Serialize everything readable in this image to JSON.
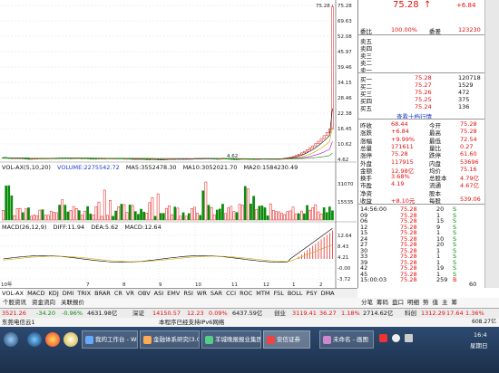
{
  "chart_data": [
    {
      "type": "candlestick",
      "name": "kline",
      "y_ticks": [
        "75.28",
        "69.63",
        "52.08",
        "45.97",
        "39.46",
        "34.15",
        "28.46",
        "22.38",
        "16.45",
        "10.62",
        "4.62"
      ],
      "max_label": "75.28",
      "min_label": "4.62"
    },
    {
      "type": "bar",
      "name": "volume",
      "y_ticks": [
        "31070",
        "15535"
      ]
    },
    {
      "type": "line",
      "name": "macd",
      "y_ticks": [
        "12.64",
        "8.43",
        "4.21",
        "-0.00",
        "-3.72"
      ]
    }
  ],
  "vol": {
    "title": "VOL-AX(5,10,20)",
    "volume": "VOLUME:2275542.72",
    "ma5": "MA5:3552478.30",
    "ma10": "MA10:3052021.70",
    "ma20": "MA20:1584230.49"
  },
  "macd": {
    "title": "MACD(26,12,9)",
    "diff": "DIFF:11.94",
    "dea": "DEA:5.62",
    "macd": "MACD:12.64"
  },
  "x_label": "10年",
  "x_ticks": [
    "7",
    "8",
    "9",
    "10",
    "11",
    "12",
    "1",
    "2"
  ],
  "panel": {
    "price": "75.28",
    "arrow": "↑",
    "change": "+6.84",
    "weibi": {
      "label": "委比",
      "val": "100.00%",
      "label2": "委差",
      "val2": "123230"
    },
    "sell": [
      {
        "l": "卖五",
        "p": "",
        "v": ""
      },
      {
        "l": "卖四",
        "p": "",
        "v": ""
      },
      {
        "l": "卖三",
        "p": "",
        "v": ""
      },
      {
        "l": "卖二",
        "p": "",
        "v": ""
      },
      {
        "l": "卖一",
        "p": "",
        "v": ""
      }
    ],
    "buy": [
      {
        "l": "买一",
        "p": "75.28",
        "v": "120718"
      },
      {
        "l": "买二",
        "p": "75.27",
        "v": "1529"
      },
      {
        "l": "买三",
        "p": "75.26",
        "v": "472"
      },
      {
        "l": "买四",
        "p": "75.25",
        "v": "375"
      },
      {
        "l": "买五",
        "p": "75.24",
        "v": "136"
      }
    ],
    "more": "查看十档行情",
    "stats": [
      {
        "l1": "昨收",
        "v1": "68.44",
        "l2": "今开",
        "v2": "75.28"
      },
      {
        "l1": "涨跌",
        "v1": "+6.84",
        "l2": "最高",
        "v2": "75.28"
      },
      {
        "l1": "涨幅",
        "v1": "+9.99%",
        "l2": "最低",
        "v2": "72.54"
      },
      {
        "l1": "总量",
        "v1": "171611",
        "l2": "量比",
        "v2": "0.27"
      },
      {
        "l1": "涨停",
        "v1": "75.28",
        "l2": "跌停",
        "v2": "61.60"
      },
      {
        "l1": "外盘",
        "v1": "117915",
        "l2": "内盘",
        "v2": "53696"
      },
      {
        "l1": "金额",
        "v1": "12.98亿",
        "l2": "均价",
        "v2": "75.16"
      },
      {
        "l1": "换手",
        "v1": "3.68%",
        "l2": "总股本",
        "v2": "4.79亿"
      },
      {
        "l1": "市盈",
        "v1": "4.19",
        "l2": "流通",
        "v2": "4.67亿"
      },
      {
        "l1": "净资",
        "v1": "",
        "l2": "股本",
        "v2": ""
      },
      {
        "l1": "收益",
        "v1": "+8.10元",
        "l2": "每股",
        "v2": "539.06"
      }
    ],
    "ticks": [
      {
        "t": "14:56:00",
        "p": "75.28",
        "v": "20",
        "d": "S"
      },
      {
        "t": "09",
        "p": "75.28",
        "v": "1",
        "d": "S"
      },
      {
        "t": "06",
        "p": "75.28",
        "v": "15",
        "d": "S"
      },
      {
        "t": "12",
        "p": "75.28",
        "v": "9",
        "d": "S"
      },
      {
        "t": "15",
        "p": "75.28",
        "v": "1",
        "d": "S"
      },
      {
        "t": "24",
        "p": "75.28",
        "v": "10",
        "d": "S"
      },
      {
        "t": "27",
        "p": "75.28",
        "v": "20",
        "d": "S"
      },
      {
        "t": "30",
        "p": "75.28",
        "v": "1",
        "d": "S"
      },
      {
        "t": "33",
        "p": "75.28",
        "v": "1",
        "d": "S"
      },
      {
        "t": "39",
        "p": "75.28",
        "v": "1",
        "d": "S"
      },
      {
        "t": "42",
        "p": "75.28",
        "v": "19",
        "d": "S"
      },
      {
        "t": "45",
        "p": "75.28",
        "v": "1",
        "d": "S"
      },
      {
        "t": "15:00:03",
        "p": "75.28",
        "v": "259",
        "d": "B"
      }
    ],
    "tick_extra": "60"
  },
  "tabs": [
    "VOL-AX",
    "MACD",
    "KDJ",
    "DMI",
    "TRIX",
    "BRAR",
    "CR",
    "VR",
    "OBV",
    "ASI",
    "EMV",
    "RSI",
    "WR",
    "SAR",
    "CCI",
    "ROC",
    "MTM",
    "FSL",
    "BOLL",
    "PSY",
    "DMA"
  ],
  "tabs2": [
    "个股资讯",
    "资金流向",
    "关联报价"
  ],
  "rtabs": [
    "分笔",
    "筹码",
    "盘口",
    "明细",
    "势",
    "值",
    "主",
    "筹"
  ],
  "status": {
    "s1": "3521.26",
    "s2": "-34.20",
    "s3": "-0.96%",
    "s4": "4631.98亿",
    "s5": "深证",
    "s6": "14150.57",
    "s7": "12.23",
    "s8": "0.09%",
    "s9": "6437.59亿",
    "s10": "创业",
    "s11": "3119.41",
    "s12": "36.27",
    "s13": "1.18%",
    "s14": "2714.62亿",
    "s15": "科创",
    "s16": "1312.29",
    "s17": "17.64",
    "s18": "1.36%",
    "s19": "608.27亿"
  },
  "ticker": {
    "left": "东莞电信云1",
    "msg": "本程序已经支持IPv6网络"
  },
  "taskbar": {
    "apps": [
      "我的工作台 - Win...",
      "金融体系研究(3.0-...",
      "羊城晚报报业集团...",
      "安信证券",
      "未命名 - 画图"
    ],
    "time": "16:4",
    "day": "星期日"
  }
}
